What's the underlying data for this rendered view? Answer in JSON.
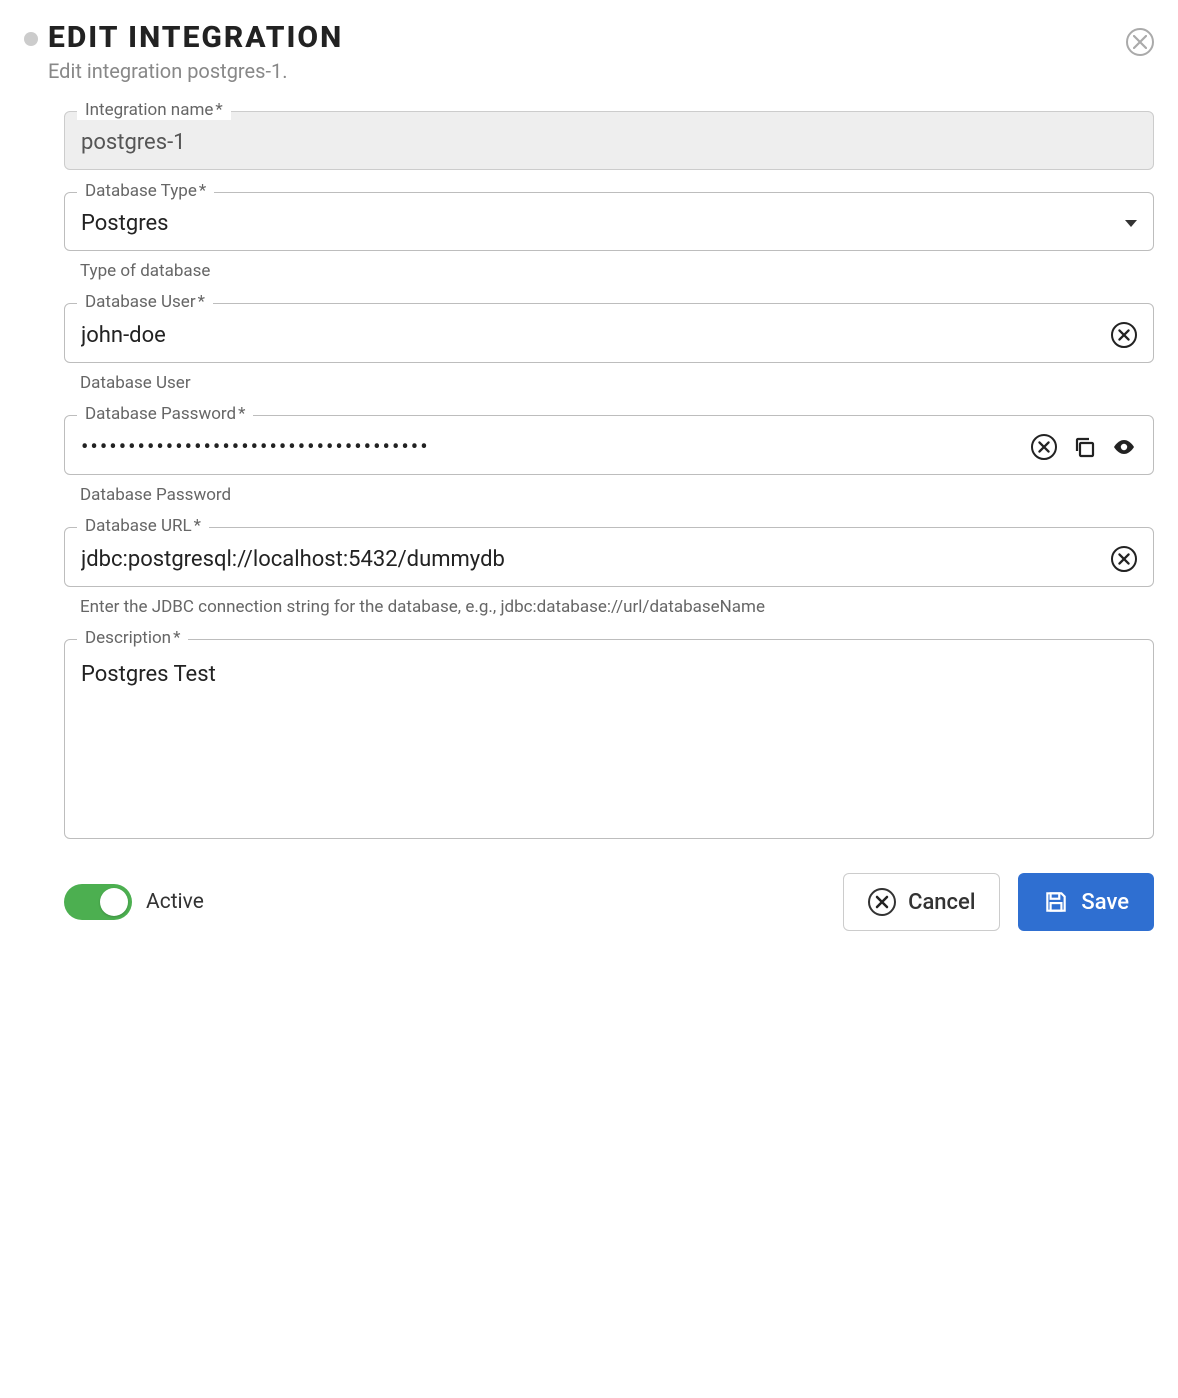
{
  "header": {
    "title": "Edit Integration",
    "subtitle": "Edit integration postgres-1."
  },
  "fields": {
    "integration_name": {
      "label": "Integration name",
      "required_marker": "*",
      "value": "postgres-1"
    },
    "database_type": {
      "label": "Database Type",
      "required_marker": "*",
      "value": "Postgres",
      "helper": "Type of database"
    },
    "database_user": {
      "label": "Database User",
      "required_marker": "*",
      "value": "john-doe",
      "helper": "Database User"
    },
    "database_password": {
      "label": "Database Password",
      "required_marker": "*",
      "value": "•••••••••••••••••••••••••••••••••••••",
      "helper": "Database Password"
    },
    "database_url": {
      "label": "Database URL",
      "required_marker": "*",
      "value": "jdbc:postgresql://localhost:5432/dummydb",
      "helper": "Enter the JDBC connection string for the database, e.g., jdbc:database://url/databaseName"
    },
    "description": {
      "label": "Description",
      "required_marker": "*",
      "value": "Postgres Test"
    }
  },
  "footer": {
    "toggle_label": "Active",
    "cancel_label": "Cancel",
    "save_label": "Save"
  }
}
